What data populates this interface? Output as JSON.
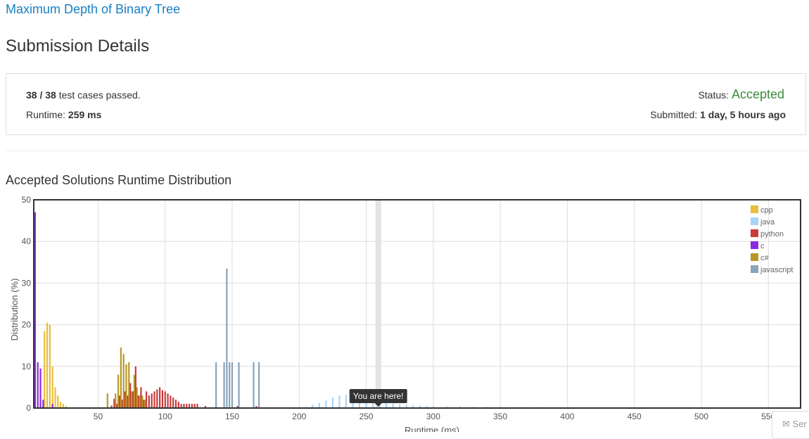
{
  "problem": {
    "title": "Maximum Depth of Binary Tree"
  },
  "page_title": "Submission Details",
  "summary": {
    "cases_passed": "38 / 38",
    "cases_suffix": "test cases passed.",
    "runtime_label": "Runtime:",
    "runtime_value": "259 ms",
    "status_label": "Status:",
    "status_value": "Accepted",
    "submitted_label": "Submitted:",
    "submitted_value": "1 day, 5 hours ago"
  },
  "distribution_title": "Accepted Solutions Runtime Distribution",
  "send_button": {
    "label": "Ser"
  },
  "colors": {
    "cpp": "#e8bf3c",
    "java": "#a9d4f5",
    "python": "#c93a3a",
    "c": "#8a2be2",
    "csharp": "#b8962a",
    "javascript": "#8aa4bb",
    "accepted": "#3c8b3c",
    "link": "#1a7fc2"
  },
  "chart_data": {
    "type": "bar",
    "xlabel": "Runtime (ms)",
    "ylabel": "Distribution (%)",
    "xlim": [
      2,
      574
    ],
    "ylim": [
      0,
      50
    ],
    "xticks": [
      50,
      100,
      150,
      200,
      250,
      300,
      350,
      400,
      450,
      500,
      550
    ],
    "yticks": [
      0,
      10,
      20,
      30,
      40,
      50
    ],
    "grid": true,
    "legend_position": "top-right",
    "marker": {
      "x": 259,
      "label": "You are here!"
    },
    "series": [
      {
        "name": "cpp",
        "color": "#e8bf3c",
        "x": [
          10,
          12,
          14,
          16,
          18,
          20,
          22,
          24,
          26
        ],
        "y": [
          18.5,
          20.5,
          20,
          10,
          5,
          3,
          1.5,
          1,
          0.5
        ]
      },
      {
        "name": "java",
        "color": "#a9d4f5",
        "x": [
          205,
          210,
          215,
          220,
          225,
          230,
          235,
          240,
          245,
          250,
          255,
          260,
          265,
          270,
          275,
          280,
          285,
          290,
          295,
          300,
          310,
          320,
          330,
          340,
          350,
          360,
          370,
          380,
          390,
          400,
          420,
          440,
          460,
          480,
          500,
          520,
          540,
          560
        ],
        "y": [
          0.3,
          0.8,
          1.2,
          1.8,
          2.5,
          3,
          3.2,
          3,
          2.6,
          2.2,
          1.9,
          1.6,
          1.3,
          1.1,
          0.9,
          0.8,
          0.7,
          0.6,
          0.5,
          0.5,
          0.4,
          0.4,
          0.3,
          0.3,
          0.3,
          0.2,
          0.2,
          0.2,
          0.1,
          0.1,
          0.1,
          0.1,
          0.1,
          0.1,
          0.1,
          0.1,
          0.1,
          0.1
        ]
      },
      {
        "name": "python",
        "color": "#c93a3a",
        "x": [
          60,
          62,
          64,
          66,
          68,
          70,
          72,
          74,
          76,
          78,
          80,
          82,
          84,
          86,
          88,
          90,
          92,
          94,
          96,
          98,
          100,
          102,
          104,
          106,
          108,
          110,
          112,
          114,
          116,
          118,
          120,
          122,
          124,
          130,
          154,
          168
        ],
        "y": [
          0.6,
          2.2,
          1,
          3,
          2,
          4,
          3,
          6,
          4,
          10,
          3,
          5,
          2,
          4,
          3,
          3.5,
          4,
          4.5,
          5,
          4.3,
          4,
          3.5,
          3,
          2.5,
          2,
          1.5,
          1,
          1,
          1,
          1,
          1,
          1,
          1,
          0.5,
          0.5,
          0.5
        ]
      },
      {
        "name": "c",
        "color": "#8a2be2",
        "x": [
          3,
          5,
          7,
          9,
          16
        ],
        "y": [
          47,
          11,
          9.5,
          2,
          1
        ]
      },
      {
        "name": "c#",
        "color": "#b8962a",
        "x": [
          57,
          63,
          65,
          67,
          69,
          71,
          73,
          75,
          77,
          79,
          81,
          83,
          85
        ],
        "y": [
          3.5,
          3.5,
          8,
          14.5,
          13,
          10.5,
          11,
          4,
          8,
          5,
          3,
          3,
          2
        ]
      },
      {
        "name": "javascript",
        "color": "#8aa4bb",
        "x": [
          138,
          144,
          146,
          148,
          150,
          155,
          166,
          170
        ],
        "y": [
          11,
          11,
          33.5,
          11,
          11,
          11,
          11,
          11
        ]
      }
    ]
  }
}
